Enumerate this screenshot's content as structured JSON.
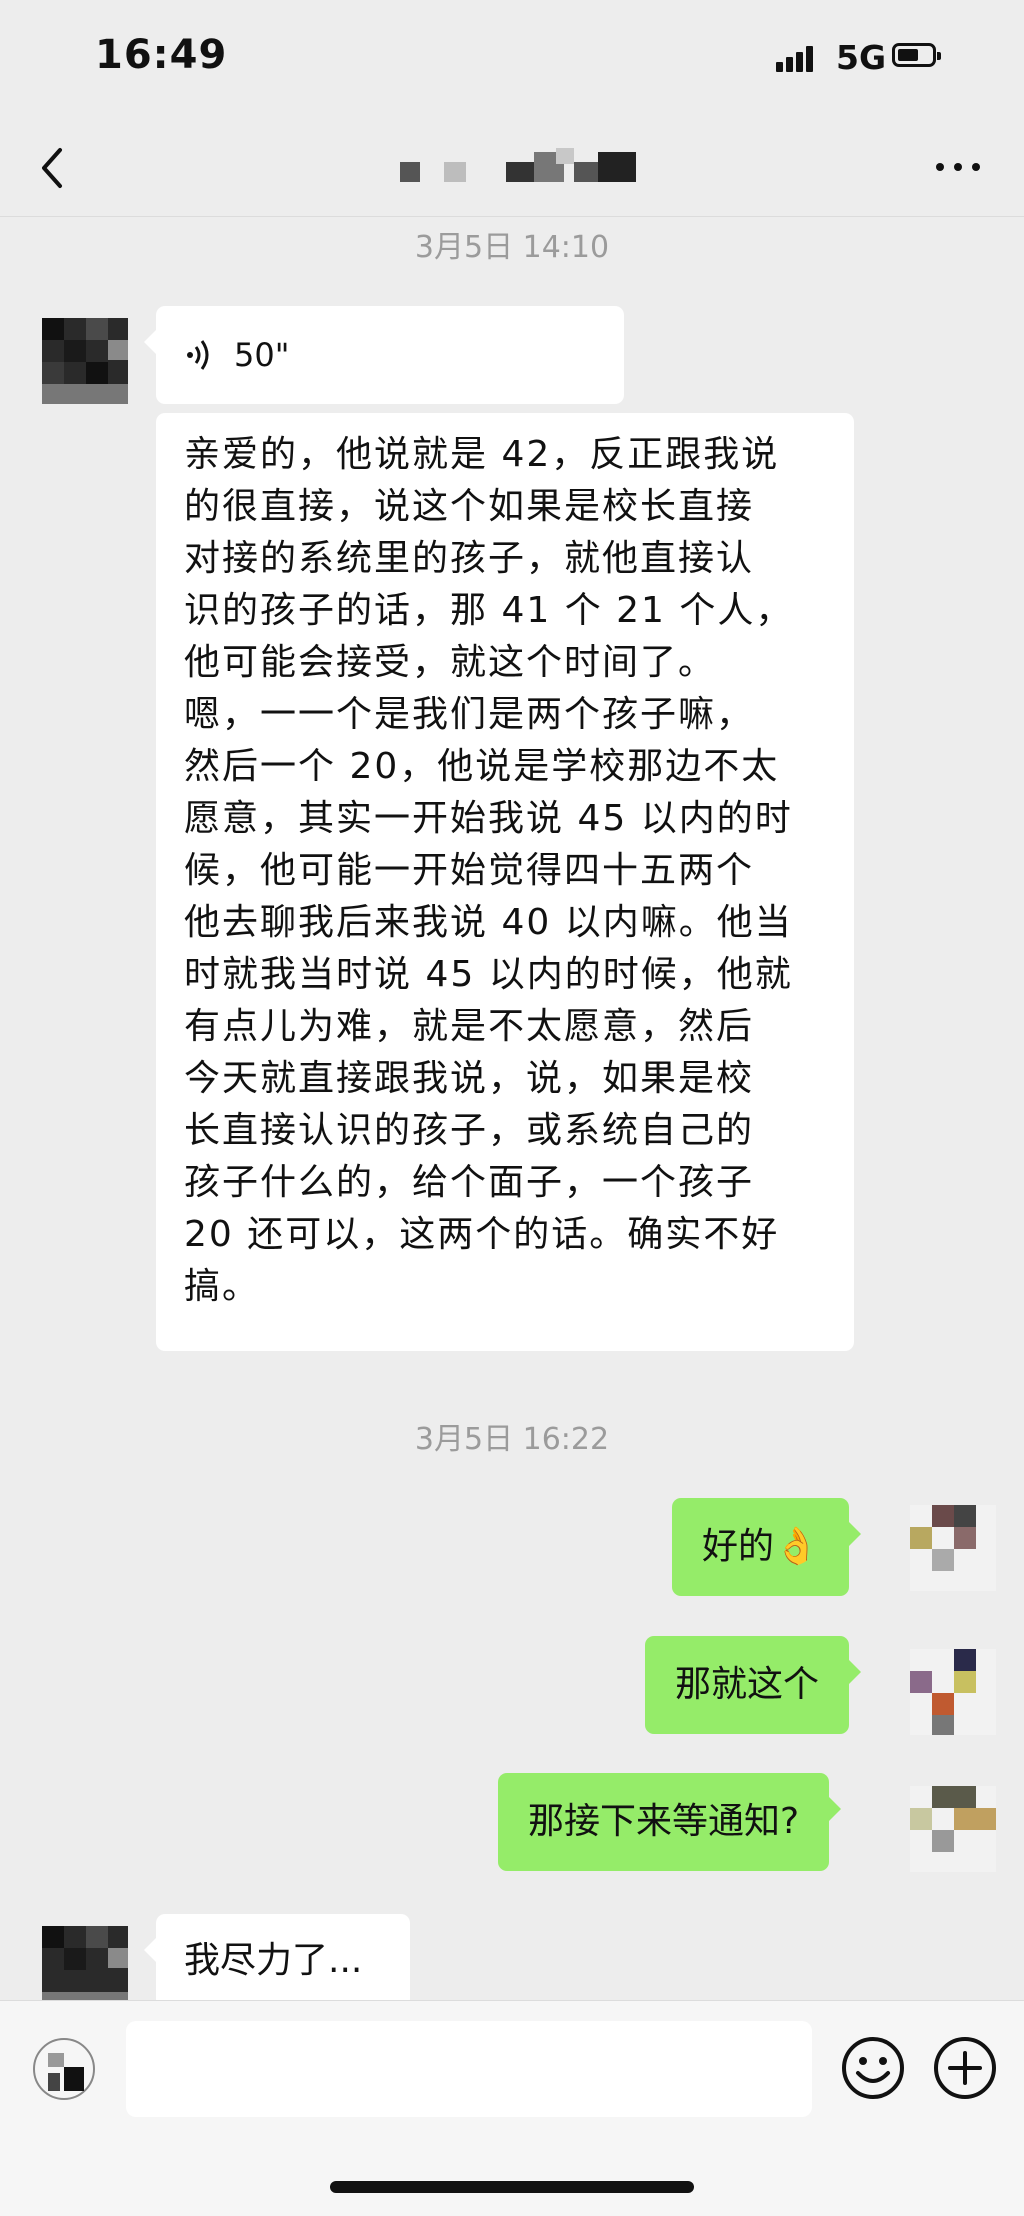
{
  "status_bar": {
    "time": "16:49",
    "network": "5G"
  },
  "timestamps": [
    "3月5日 14:10",
    "3月5日 16:22"
  ],
  "messages": {
    "voice": {
      "duration": "50\""
    },
    "long_text": "亲爱的，他说就是 42，反正跟我说\n的很直接，说这个如果是校长直接\n对接的系统里的孩子，就他直接认\n识的孩子的话，那 41 个 21 个人，\n他可能会接受，就这个时间了。\n嗯，一一个是我们是两个孩子嘛，\n然后一个 20，他说是学校那边不太\n愿意，其实一开始我说 45 以内的时\n候，他可能一开始觉得四十五两个\n他去聊我后来我说 40 以内嘛。他当\n时就我当时说 45 以内的时候，他就\n有点儿为难，就是不太愿意，然后\n今天就直接跟我说，说，如果是校\n长直接认识的孩子，或系统自己的\n孩子什么的，给个面子，一个孩子\n20 还可以，这两个的话。确实不好\n搞。",
    "out_1": "好的👌",
    "out_2": "那就这个",
    "out_3": "那接下来等通知?",
    "in_last": "我尽力了..."
  },
  "colors": {
    "outgoing_bubble": "#95ec69",
    "incoming_bubble": "#ffffff",
    "background": "#ededed"
  },
  "icons": [
    "chevron-left-icon",
    "more-icon",
    "voice-wave-icon",
    "voice-toggle-icon",
    "emoji-icon",
    "plus-icon"
  ]
}
